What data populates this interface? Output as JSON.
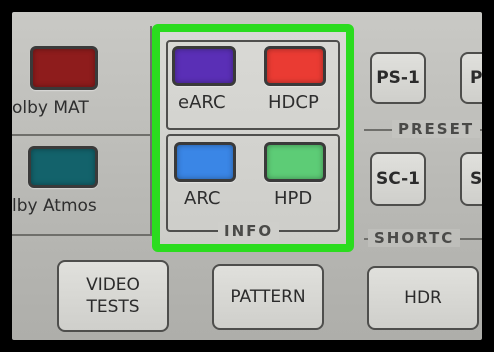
{
  "left_panel": {
    "row1_label": "olby MAT",
    "row2_label": "lby Atmos"
  },
  "info": {
    "section_label": "INFO",
    "buttons": [
      {
        "label": "eARC",
        "color": "#5a2fb6"
      },
      {
        "label": "HDCP",
        "color": "#ea3b33"
      },
      {
        "label": "ARC",
        "color": "#3a86e6"
      },
      {
        "label": "HPD",
        "color": "#5dcc76"
      }
    ]
  },
  "right_panel": {
    "preset_label": "PRESET",
    "shortcut_label": "SHORTC",
    "preset_button": "PS-1",
    "shortcut_button": "SC-1",
    "preset_button2": "P",
    "shortcut_button2": "S"
  },
  "bottom": {
    "video_tests": "VIDEO\nTESTS",
    "pattern": "PATTERN",
    "hdr": "HDR"
  },
  "colors": {
    "highlight": "#2bdc1f",
    "dolby_mat_led": "#8e1c1c",
    "dolby_atmos_led": "#13626b"
  }
}
